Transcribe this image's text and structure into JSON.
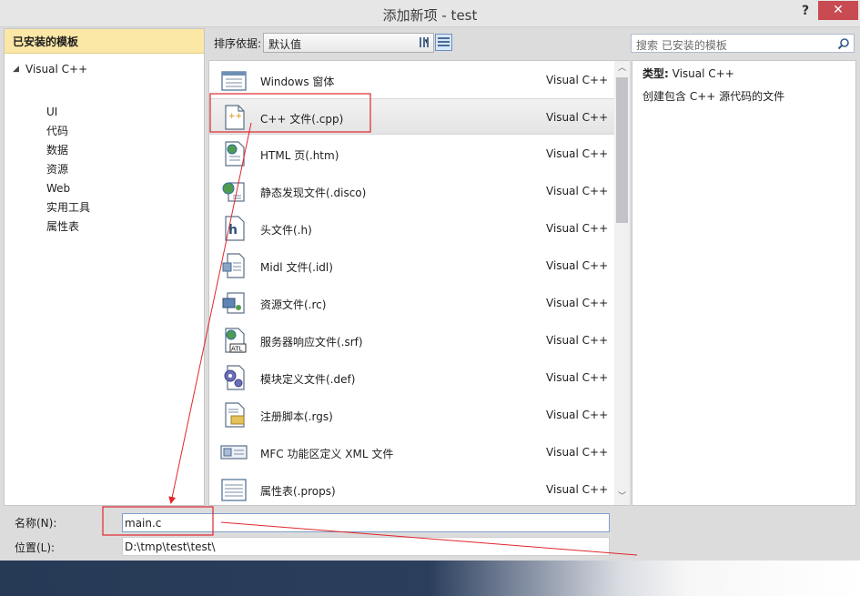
{
  "window": {
    "title": "添加新项 - test",
    "help_label": "?",
    "close_label": "✕"
  },
  "sidebar": {
    "header": "已安装的模板",
    "root": {
      "label": "Visual C++",
      "arrow": "◢"
    },
    "children": [
      "UI",
      "代码",
      "数据",
      "资源",
      "Web",
      "实用工具",
      "属性表"
    ]
  },
  "toolbar": {
    "sort_label": "排序依据:",
    "sort_value": "默认值",
    "caret": "▾"
  },
  "search": {
    "placeholder": "搜索 已安装的模板"
  },
  "templates": [
    {
      "name": "Windows 窗体",
      "lang": "Visual C++",
      "icon": "form-icon"
    },
    {
      "name": "C++ 文件(.cpp)",
      "lang": "Visual C++",
      "icon": "cpp-file-icon",
      "selected": true
    },
    {
      "name": "HTML 页(.htm)",
      "lang": "Visual C++",
      "icon": "html-page-icon"
    },
    {
      "name": "静态发现文件(.disco)",
      "lang": "Visual C++",
      "icon": "disco-file-icon"
    },
    {
      "name": "头文件(.h)",
      "lang": "Visual C++",
      "icon": "header-file-icon"
    },
    {
      "name": "Midl 文件(.idl)",
      "lang": "Visual C++",
      "icon": "idl-file-icon"
    },
    {
      "name": "资源文件(.rc)",
      "lang": "Visual C++",
      "icon": "resource-file-icon"
    },
    {
      "name": "服务器响应文件(.srf)",
      "lang": "Visual C++",
      "icon": "atl-srf-icon"
    },
    {
      "name": "模块定义文件(.def)",
      "lang": "Visual C++",
      "icon": "def-file-icon"
    },
    {
      "name": "注册脚本(.rgs)",
      "lang": "Visual C++",
      "icon": "rgs-file-icon"
    },
    {
      "name": "MFC 功能区定义 XML 文件",
      "lang": "Visual C++",
      "icon": "mfc-ribbon-icon"
    },
    {
      "name": "属性表(.props)",
      "lang": "Visual C++",
      "icon": "props-file-icon"
    }
  ],
  "description": {
    "type_label": "类型:",
    "type_value": "Visual C++",
    "text": "创建包含 C++ 源代码的文件"
  },
  "form": {
    "name_label": "名称(N):",
    "name_value": "main.c",
    "location_label": "位置(L):",
    "location_value": "D:\\tmp\\test\\test\\"
  },
  "scrollbar": {
    "up": "︿",
    "down": "﹀"
  },
  "colors": {
    "header_bg": "#fbe7a6",
    "close_button": "#c74b50",
    "annotation": "#e0262b",
    "footer": "#263a56"
  }
}
